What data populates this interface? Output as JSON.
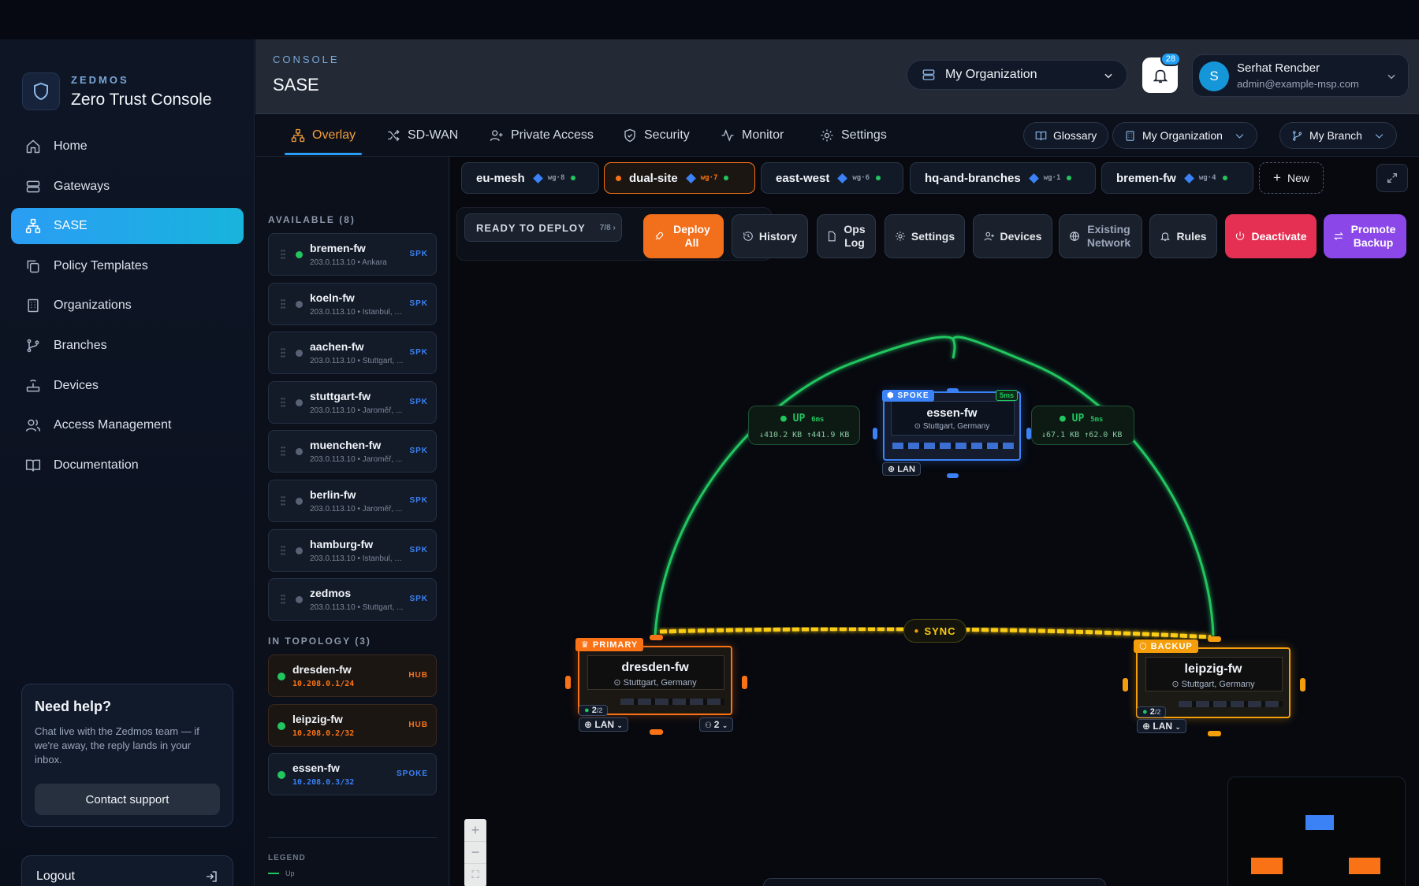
{
  "brand": {
    "kicker": "ZEDMOS",
    "title": "Zero Trust Console"
  },
  "nav": [
    {
      "label": "Home",
      "icon": "home-icon"
    },
    {
      "label": "Gateways",
      "icon": "server-icon"
    },
    {
      "label": "SASE",
      "icon": "network-icon",
      "active": true
    },
    {
      "label": "Policy Templates",
      "icon": "copy-icon"
    },
    {
      "label": "Organizations",
      "icon": "building-icon"
    },
    {
      "label": "Branches",
      "icon": "git-branch-icon"
    },
    {
      "label": "Devices",
      "icon": "router-icon"
    },
    {
      "label": "Access Management",
      "icon": "users-icon"
    },
    {
      "label": "Documentation",
      "icon": "book-icon"
    }
  ],
  "help": {
    "title": "Need help?",
    "text": "Chat live with the Zedmos team — if we're away, the reply lands in your inbox.",
    "button": "Contact support"
  },
  "logout": "Logout",
  "header": {
    "kicker": "CONSOLE",
    "title": "SASE",
    "org_selector": "My Organization",
    "notification_count": "28",
    "user_initial": "S",
    "user_name": "Serhat Rencber",
    "user_email": "admin@example-msp.com"
  },
  "tabs": [
    {
      "label": "Overlay",
      "active": true
    },
    {
      "label": "SD-WAN"
    },
    {
      "label": "Private Access"
    },
    {
      "label": "Security"
    },
    {
      "label": "Monitor"
    },
    {
      "label": "Settings"
    }
  ],
  "tab_actions": {
    "glossary": "Glossary",
    "organization": "My Organization",
    "branch": "My Branch"
  },
  "panel": {
    "available_title": "AVAILABLE (8)",
    "available": [
      {
        "name": "bremen-fw",
        "sub": "203.0.113.10 • Ankara",
        "role": "SPK",
        "online": true
      },
      {
        "name": "koeln-fw",
        "sub": "203.0.113.10 • Istanbul, T...",
        "role": "SPK",
        "online": false
      },
      {
        "name": "aachen-fw",
        "sub": "203.0.113.10 • Stuttgart, ...",
        "role": "SPK",
        "online": false
      },
      {
        "name": "stuttgart-fw",
        "sub": "203.0.113.10 • Jaroměř, ...",
        "role": "SPK",
        "online": false
      },
      {
        "name": "muenchen-fw",
        "sub": "203.0.113.10 • Jaroměř, ...",
        "role": "SPK",
        "online": false
      },
      {
        "name": "berlin-fw",
        "sub": "203.0.113.10 • Jaroměř, ...",
        "role": "SPK",
        "online": false
      },
      {
        "name": "hamburg-fw",
        "sub": "203.0.113.10 • Istanbul, T...",
        "role": "SPK",
        "online": false
      },
      {
        "name": "zedmos",
        "sub": "203.0.113.10 • Stuttgart, ...",
        "role": "SPK",
        "online": false
      }
    ],
    "topology_title": "IN TOPOLOGY (3)",
    "topology": [
      {
        "name": "dresden-fw",
        "sub": "10.208.0.1/24",
        "role": "HUB"
      },
      {
        "name": "leipzig-fw",
        "sub": "10.208.0.2/32",
        "role": "HUB"
      },
      {
        "name": "essen-fw",
        "sub": "10.208.0.3/32",
        "role": "SPOKE"
      }
    ],
    "legend_title": "LEGEND",
    "legend_up": "Up"
  },
  "overlays": [
    {
      "name": "eu-mesh",
      "wg": "wg·8"
    },
    {
      "name": "dual-site",
      "wg": "wg·7",
      "active": true
    },
    {
      "name": "east-west",
      "wg": "wg·6"
    },
    {
      "name": "hq-and-branches",
      "wg": "wg·1"
    },
    {
      "name": "bremen-fw",
      "wg": "wg·4"
    }
  ],
  "new_overlay": "New",
  "ready": {
    "label": "READY TO DEPLOY",
    "count": "7/8 ›"
  },
  "toolbar": {
    "deploy": "Deploy All",
    "history": "History",
    "ops_log": "Ops Log",
    "settings": "Settings",
    "devices": "Devices",
    "existing_network": "Existing Network",
    "rules": "Rules",
    "deactivate": "Deactivate",
    "promote_backup": "Promote Backup"
  },
  "topology_view": {
    "sync_label": "SYNC",
    "links": [
      {
        "status": "UP",
        "latency": "6ms",
        "rx": "↓410.2 KB",
        "tx": "↑441.9 KB"
      },
      {
        "status": "UP",
        "latency": "5ms",
        "rx": "↓67.1 KB",
        "tx": "↑62.0 KB"
      }
    ],
    "nodes": [
      {
        "id": "spoke",
        "badge": "SPOKE",
        "name": "essen-fw",
        "location": "Stuttgart, Germany",
        "latency": "5ms",
        "iface": "LAN",
        "color": "#3b82f6"
      },
      {
        "id": "primary",
        "badge": "PRIMARY",
        "name": "dresden-fw",
        "location": "Stuttgart, Germany",
        "ports": "2",
        "ports_total": "/2",
        "iface": "LAN",
        "peers": "2",
        "color": "#f97316"
      },
      {
        "id": "backup",
        "badge": "BACKUP",
        "name": "leipzig-fw",
        "location": "Stuttgart, Germany",
        "ports": "2",
        "ports_total": "/2",
        "iface": "LAN",
        "color": "#f59e0b"
      }
    ]
  },
  "colors": {
    "accent": "#2a9df4",
    "orange": "#f97316",
    "link_up": "#22c55e",
    "sync": "#facc15",
    "danger": "#e52f53",
    "promote": "#8b47e8"
  }
}
